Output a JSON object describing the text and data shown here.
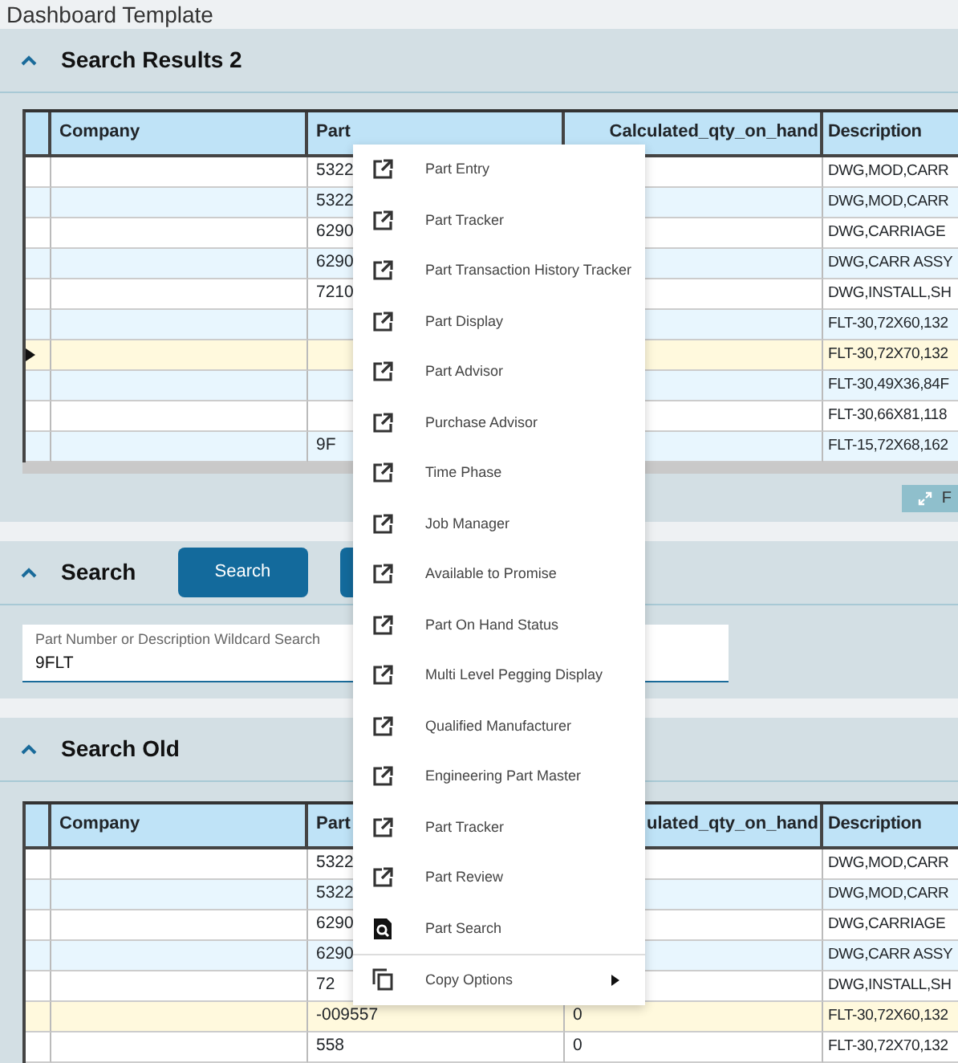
{
  "page_title": "Dashboard Template",
  "results_panel": {
    "title": "Search Results 2",
    "expanded": true,
    "columns": [
      "Company",
      "Part",
      "Calculated_qty_on_hand",
      "Description"
    ],
    "rows": [
      {
        "part": "5322",
        "qty": "",
        "description": "DWG,MOD,CARR",
        "selected": false,
        "current": false
      },
      {
        "part": "5322",
        "qty": "",
        "description": "DWG,MOD,CARR",
        "selected": false,
        "current": false
      },
      {
        "part": "6290",
        "qty": "",
        "description": "DWG,CARRIAGE",
        "selected": false,
        "current": false
      },
      {
        "part": "6290",
        "qty": "",
        "description": "DWG,CARR ASSY",
        "selected": false,
        "current": false
      },
      {
        "part": "7210",
        "qty": "",
        "description": "DWG,INSTALL,SH",
        "selected": false,
        "current": false
      },
      {
        "part": "",
        "qty": "",
        "description": "FLT-30,72X60,132",
        "selected": false,
        "current": false
      },
      {
        "part": "",
        "qty": "",
        "description": "FLT-30,72X70,132",
        "selected": true,
        "current": true
      },
      {
        "part": "",
        "qty": "",
        "description": "FLT-30,49X36,84F",
        "selected": false,
        "current": false
      },
      {
        "part": "",
        "qty": "",
        "description": "FLT-30,66X81,118",
        "selected": false,
        "current": false
      },
      {
        "part": "9F",
        "qty": "",
        "description": "FLT-15,72X68,162",
        "selected": false,
        "current": false
      }
    ],
    "footer_button": "F"
  },
  "search_panel": {
    "title": "Search",
    "expanded": true,
    "buttons": [
      {
        "kind": "primary",
        "label": "Search"
      },
      {
        "kind": "primary"
      }
    ],
    "field": {
      "label": "Part Number or Description Wildcard Search",
      "value": "9FLT"
    }
  },
  "old_panel": {
    "title": "Search Old",
    "expanded": true,
    "columns": [
      "Company",
      "Part",
      "ulated_qty_on_hand",
      "Description"
    ],
    "rows": [
      {
        "part": "5322",
        "qty": "",
        "description": "DWG,MOD,CARR",
        "selected": false,
        "current": false
      },
      {
        "part": "5322",
        "qty": "",
        "description": "DWG,MOD,CARR",
        "selected": false,
        "current": false
      },
      {
        "part": "6290",
        "qty": "",
        "description": "DWG,CARRIAGE",
        "selected": false,
        "current": false
      },
      {
        "part": "6290",
        "qty": "",
        "description": "DWG,CARR ASSY",
        "selected": false,
        "current": false
      },
      {
        "part": "72",
        "qty": "",
        "description": "DWG,INSTALL,SH",
        "selected": false,
        "current": false
      },
      {
        "part": "-009557",
        "qty": "0",
        "description": "FLT-30,72X60,132",
        "selected": true,
        "current": false
      },
      {
        "part": "558",
        "qty": "0",
        "description": "FLT-30,72X70,132",
        "selected": false,
        "current": false
      }
    ]
  },
  "context_menu": [
    {
      "label": "Part Entry",
      "kind": "link"
    },
    {
      "label": "Part Tracker",
      "kind": "link"
    },
    {
      "label": "Part Transaction History Tracker",
      "kind": "link"
    },
    {
      "label": "Part Display",
      "kind": "link"
    },
    {
      "label": "Part Advisor",
      "kind": "link"
    },
    {
      "label": "Purchase Advisor",
      "kind": "link"
    },
    {
      "label": "Time Phase",
      "kind": "link"
    },
    {
      "label": "Job Manager",
      "kind": "link"
    },
    {
      "label": "Available to Promise",
      "kind": "link"
    },
    {
      "label": "Part On Hand Status",
      "kind": "link"
    },
    {
      "label": "Multi Level Pegging Display",
      "kind": "link"
    },
    {
      "label": "Qualified Manufacturer",
      "kind": "link"
    },
    {
      "label": "Engineering Part Master",
      "kind": "link"
    },
    {
      "label": "Part Tracker",
      "kind": "link"
    },
    {
      "label": "Part Review",
      "kind": "link"
    },
    {
      "label": "Part Search",
      "kind": "search"
    },
    {
      "label": "Copy Options",
      "kind": "submenu"
    }
  ]
}
